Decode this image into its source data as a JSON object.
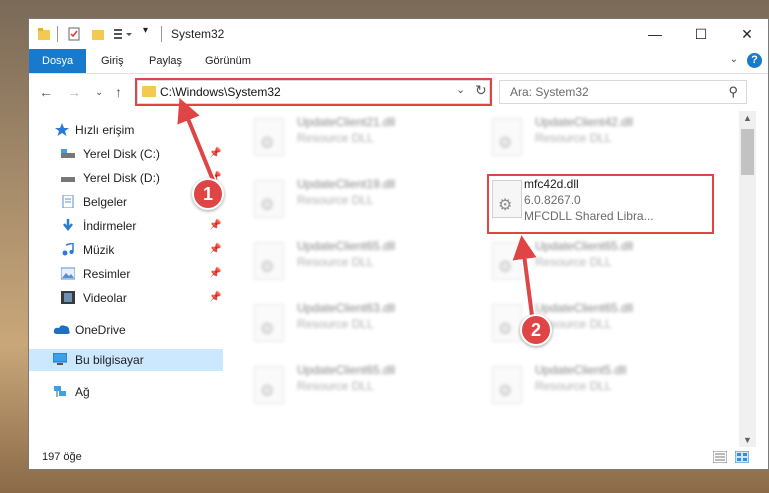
{
  "window": {
    "title": "System32",
    "ribbon_tabs": [
      "Dosya",
      "Giriş",
      "Paylaş",
      "Görünüm"
    ],
    "help": "?"
  },
  "nav": {
    "address": "C:\\Windows\\System32",
    "search_placeholder": "Ara: System32"
  },
  "sidebar": {
    "items": [
      {
        "label": "Hızlı erişim",
        "icon": "star-icon",
        "pinned": false
      },
      {
        "label": "Yerel Disk (C:)",
        "icon": "drive-icon",
        "pinned": true
      },
      {
        "label": "Yerel Disk (D:)",
        "icon": "drive-icon",
        "pinned": true
      },
      {
        "label": "Belgeler",
        "icon": "documents-icon",
        "pinned": true
      },
      {
        "label": "İndirmeler",
        "icon": "download-icon",
        "pinned": true
      },
      {
        "label": "Müzik",
        "icon": "music-icon",
        "pinned": true
      },
      {
        "label": "Resimler",
        "icon": "pictures-icon",
        "pinned": true
      },
      {
        "label": "Videolar",
        "icon": "video-icon",
        "pinned": true
      },
      {
        "label": "OneDrive",
        "icon": "cloud-icon",
        "pinned": false
      },
      {
        "label": "Bu bilgisayar",
        "icon": "computer-icon",
        "pinned": false,
        "selected": true
      },
      {
        "label": "Ağ",
        "icon": "network-icon",
        "pinned": false
      }
    ]
  },
  "files": {
    "left": [
      {
        "name": "UpdateClient21.dll",
        "type": "Resource DLL"
      },
      {
        "name": "UpdateClient19.dll",
        "type": "Resource DLL"
      },
      {
        "name": "UpdateClient65.dll",
        "type": "Resource DLL"
      },
      {
        "name": "UpdateClient63.dll",
        "type": "Resource DLL"
      },
      {
        "name": "UpdateClient65.dll",
        "type": "Resource DLL"
      }
    ],
    "right": [
      {
        "name": "UpdateClient42.dll",
        "type": "Resource DLL"
      },
      {
        "name": "mfc42d.dll",
        "version": "6.0.8267.0",
        "type": "MFCDLL Shared Libra...",
        "highlighted": true
      },
      {
        "name": "UpdateClient65.dll",
        "type": "Resource DLL"
      },
      {
        "name": "UpdateClient65.dll",
        "type": "Resource DLL"
      },
      {
        "name": "UpdateClient5.dll",
        "type": "Resource DLL"
      }
    ]
  },
  "status": {
    "count": "197 öğe"
  },
  "callouts": [
    "1",
    "2"
  ],
  "colors": {
    "accent": "#1979ca",
    "highlight": "#e04545",
    "selection": "#cce8ff"
  }
}
